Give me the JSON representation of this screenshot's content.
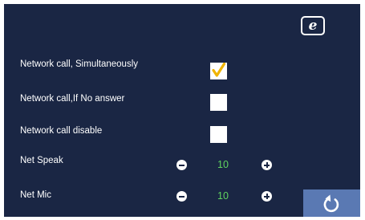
{
  "colors": {
    "background": "#1a2644",
    "text": "#ffffff",
    "value": "#5fd35f",
    "check": "#f0b400",
    "back_button": "#5a79b3"
  },
  "header": {
    "browser_icon": "internet-explorer-icon",
    "browser_glyph": "e"
  },
  "settings": [
    {
      "label": "Network call, Simultaneously",
      "checked": true
    },
    {
      "label": "Network call,If No answer",
      "checked": false
    },
    {
      "label": "Network call disable",
      "checked": false
    }
  ],
  "levels": [
    {
      "label": "Net Speak",
      "value": "10"
    },
    {
      "label": "Net Mic",
      "value": "10"
    }
  ],
  "icons": {
    "decrease": "minus-circle-icon",
    "increase": "plus-circle-icon",
    "back": "back-arrow-icon"
  }
}
